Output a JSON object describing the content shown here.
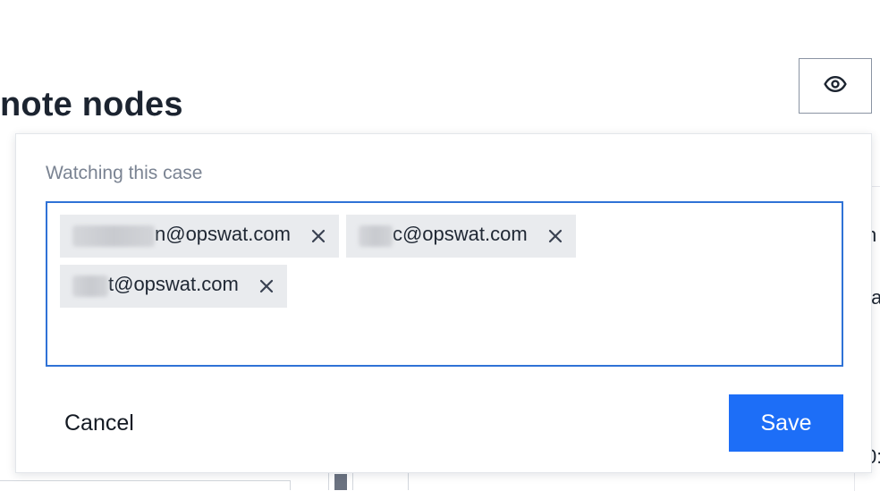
{
  "background": {
    "page_title": "note nodes",
    "edge_texts": [
      "n",
      "ta",
      "0:"
    ]
  },
  "toolbar": {
    "eye_icon": "eye-icon"
  },
  "watchers_popover": {
    "label": "Watching this case",
    "chips": [
      {
        "visible_text": "n@opswat.com",
        "remove_icon": "close-icon"
      },
      {
        "visible_text": "c@opswat.com",
        "remove_icon": "close-icon"
      },
      {
        "visible_text": "t@opswat.com",
        "remove_icon": "close-icon"
      }
    ],
    "cancel_label": "Cancel",
    "save_label": "Save"
  },
  "colors": {
    "accent": "#1d6ef7",
    "input_border": "#2f72d6",
    "chip_bg": "#e9ebee",
    "label": "#7a8392"
  }
}
